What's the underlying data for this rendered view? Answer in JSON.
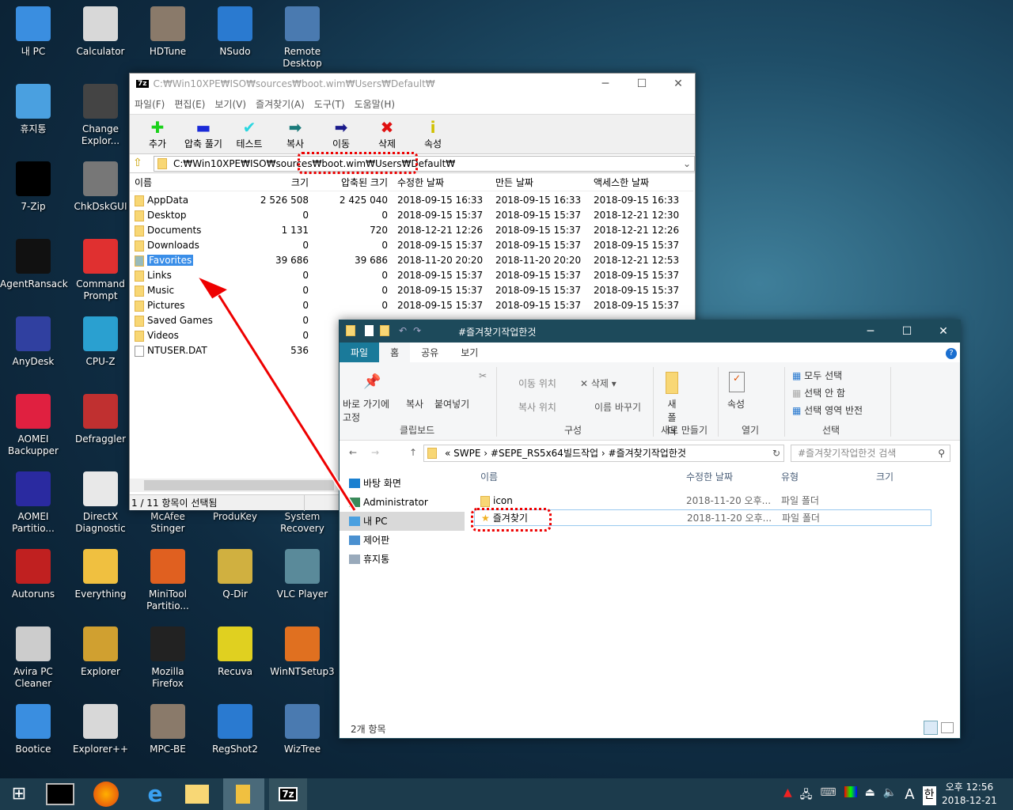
{
  "desktop": {
    "icons": [
      [
        "내 PC",
        "Calculator",
        "HDTune",
        "NSudo",
        "Remote Desktop"
      ],
      [
        "휴지통",
        "Change Explor..."
      ],
      [
        "7-Zip",
        "ChkDskGUI"
      ],
      [
        "AgentRansack",
        "Command Prompt"
      ],
      [
        "AnyDesk",
        "CPU-Z"
      ],
      [
        "AOMEI Backupper",
        "Defraggler"
      ],
      [
        "AOMEI Partitio...",
        "DirectX Diagnostic",
        "McAfee Stinger",
        "ProduKey",
        "System Recovery"
      ],
      [
        "Autoruns",
        "Everything",
        "MiniTool Partitio...",
        "Q-Dir",
        "VLC Player"
      ],
      [
        "Avira PC Cleaner",
        "Explorer",
        "Mozilla Firefox",
        "Recuva",
        "WinNTSetup3"
      ],
      [
        "Bootice",
        "Explorer++",
        "MPC-BE",
        "RegShot2",
        "WizTree"
      ]
    ]
  },
  "sevenzip": {
    "title": "C:₩Win10XPE₩ISO₩sources₩boot.wim₩Users₩Default₩",
    "logo": "7z",
    "menu": [
      "파일(F)",
      "편집(E)",
      "보기(V)",
      "즐겨찾기(A)",
      "도구(T)",
      "도움말(H)"
    ],
    "toolbar": [
      {
        "label": "추가",
        "glyph": "✚",
        "color": "#1bd21b"
      },
      {
        "label": "압축 풀기",
        "glyph": "▬",
        "color": "#1a2ad8"
      },
      {
        "label": "테스트",
        "glyph": "✔",
        "color": "#2ad6e0"
      },
      {
        "label": "복사",
        "glyph": "➡",
        "color": "#1a7a7a"
      },
      {
        "label": "이동",
        "glyph": "➡",
        "color": "#1a1a8a"
      },
      {
        "label": "삭제",
        "glyph": "✖",
        "color": "#e01010"
      },
      {
        "label": "속성",
        "glyph": "i",
        "color": "#d0c000"
      }
    ],
    "address": "C:₩Win10XPE₩ISO₩sources₩boot.wim₩Users₩Default₩",
    "columns": [
      "이름",
      "크기",
      "압축된 크기",
      "수정한 날짜",
      "만든 날짜",
      "액세스한 날짜"
    ],
    "rows": [
      [
        "AppData",
        "2 526 508",
        "2 425 040",
        "2018-09-15 16:33",
        "2018-09-15 16:33",
        "2018-09-15 16:33"
      ],
      [
        "Desktop",
        "0",
        "0",
        "2018-09-15 15:37",
        "2018-09-15 15:37",
        "2018-12-21 12:30"
      ],
      [
        "Documents",
        "1 131",
        "720",
        "2018-12-21 12:26",
        "2018-09-15 15:37",
        "2018-12-21 12:26"
      ],
      [
        "Downloads",
        "0",
        "0",
        "2018-09-15 15:37",
        "2018-09-15 15:37",
        "2018-09-15 15:37"
      ],
      [
        "Favorites",
        "39 686",
        "39 686",
        "2018-11-20 20:20",
        "2018-11-20 20:20",
        "2018-12-21 12:53"
      ],
      [
        "Links",
        "0",
        "0",
        "2018-09-15 15:37",
        "2018-09-15 15:37",
        "2018-09-15 15:37"
      ],
      [
        "Music",
        "0",
        "0",
        "2018-09-15 15:37",
        "2018-09-15 15:37",
        "2018-09-15 15:37"
      ],
      [
        "Pictures",
        "0",
        "0",
        "2018-09-15 15:37",
        "2018-09-15 15:37",
        "2018-09-15 15:37"
      ],
      [
        "Saved Games",
        "0",
        "",
        "",
        "",
        ""
      ],
      [
        "Videos",
        "0",
        "",
        "",
        "",
        ""
      ],
      [
        "NTUSER.DAT",
        "536",
        "",
        "",
        "",
        ""
      ]
    ],
    "selected_index": 4,
    "status_left": "1 / 11 항목이 선택됨",
    "status_right": "39 686"
  },
  "explorer": {
    "title": "#즐겨찾기작업한것",
    "tabs": [
      "파일",
      "홈",
      "공유",
      "보기"
    ],
    "ribbon": {
      "pin": "바로 가기에 고정",
      "copy": "복사",
      "paste": "붙여넣기",
      "move_to": "이동 위치",
      "copy_to": "복사 위치",
      "delete": "삭제",
      "rename": "이름 바꾸기",
      "new_folder": "새 폴더",
      "properties": "속성",
      "select_all": "모두 선택",
      "select_none": "선택 안 함",
      "invert": "선택 영역 반전",
      "groups": [
        "클립보드",
        "구성",
        "새로 만들기",
        "열기",
        "선택"
      ]
    },
    "breadcrumb": [
      "SWPE",
      "#SEPE_RS5x64빌드작업",
      "#즐겨찾기작업한것"
    ],
    "search_placeholder": "#즐겨찾기작업한것 검색",
    "nav": [
      "바탕 화면",
      "Administrator",
      "내 PC",
      "제어판",
      "휴지통"
    ],
    "columns": [
      "이름",
      "수정한 날짜",
      "유형",
      "크기"
    ],
    "rows": [
      [
        "icon",
        "2018-11-20 오후...",
        "파일 폴더"
      ],
      [
        "즐겨찾기",
        "2018-11-20 오후...",
        "파일 폴더"
      ]
    ],
    "status": "2개 항목"
  },
  "taskbar": {
    "time": "오후 12:56",
    "date": "2018-12-21",
    "ime": "한",
    "lang": "A"
  }
}
